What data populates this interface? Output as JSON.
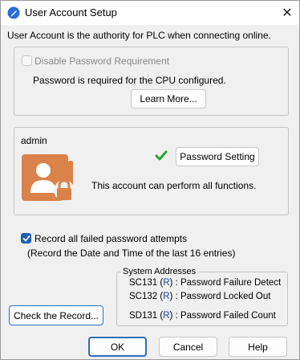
{
  "window": {
    "title": "User Account Setup",
    "close_glyph": "✕",
    "icon": "app-icon"
  },
  "intro_text": "User Account is the authority for PLC when connecting online.",
  "password_group": {
    "disable_checkbox_label": "Disable Password Requirement",
    "disable_checked": false,
    "disable_enabled": false,
    "info_text": "Password is required for the CPU configured.",
    "learn_more_label": "Learn More..."
  },
  "account_group": {
    "username": "admin",
    "status_icon": "check-icon",
    "status_color": "#2e9d3a",
    "password_setting_label": "Password Setting",
    "description": "This account can perform all functions.",
    "avatar_icon": "user-lock-icon",
    "avatar_color": "#d9834a"
  },
  "record": {
    "checkbox_label": "Record all failed password attempts",
    "checked": true,
    "note": "(Record the Date and Time of the last 16 entries)",
    "check_record_label": "Check the Record..."
  },
  "system_addresses": {
    "legend": "System Addresses",
    "items": [
      {
        "address": "SC131",
        "flag": "R",
        "desc": ": Password Failure Detect"
      },
      {
        "address": "SC132",
        "flag": "R",
        "desc": ": Password Locked Out"
      },
      {
        "address": "SD131",
        "flag": "R",
        "desc": ": Password Failed Count"
      }
    ]
  },
  "footer": {
    "ok_label": "OK",
    "cancel_label": "Cancel",
    "help_label": "Help"
  },
  "colors": {
    "accent": "#1a5fb4",
    "flag_blue": "#1d44a8"
  }
}
